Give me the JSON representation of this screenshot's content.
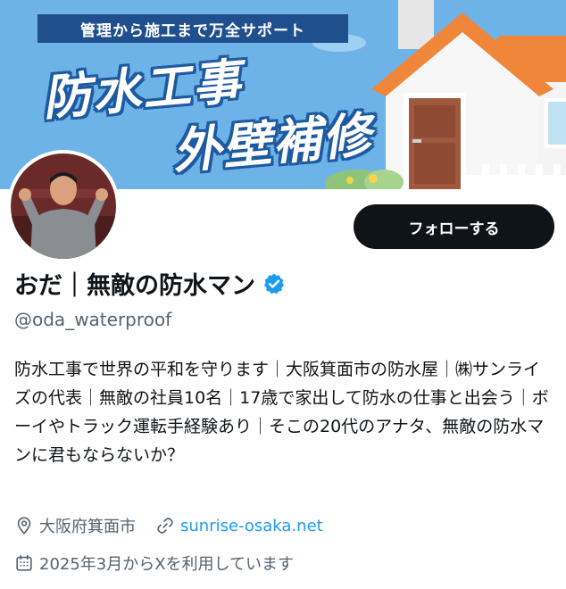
{
  "banner": {
    "tagline": "管理から施工まで万全サポート",
    "headline_line1": "防水工事",
    "headline_line2": "外壁補修"
  },
  "profile": {
    "follow_label": "フォローする",
    "display_name": "おだ｜無敵の防水マン",
    "handle": "@oda_waterproof",
    "bio": "防水工事で世界の平和を守ります｜大阪箕面市の防水屋｜㈱サンライズの代表｜無敵の社員10名｜17歳で家出して防水の仕事と出会う｜ボーイやトラック運転手経験あり｜そこの20代のアナタ、無敵の防水マンに君もならないか？",
    "location": "大阪府箕面市",
    "website": "sunrise-osaka.net",
    "joined": "2025年3月からXを利用しています"
  },
  "colors": {
    "banner_sky": "#6db3e8",
    "follow_bg": "#0f1419",
    "link": "#1d9bf0",
    "verified": "#1d9bf0",
    "secondary_text": "#536471",
    "roof": "#f0863a"
  },
  "icons": {
    "verified": "verified-badge-icon",
    "location": "location-pin-icon",
    "link": "link-icon",
    "calendar": "calendar-icon"
  }
}
